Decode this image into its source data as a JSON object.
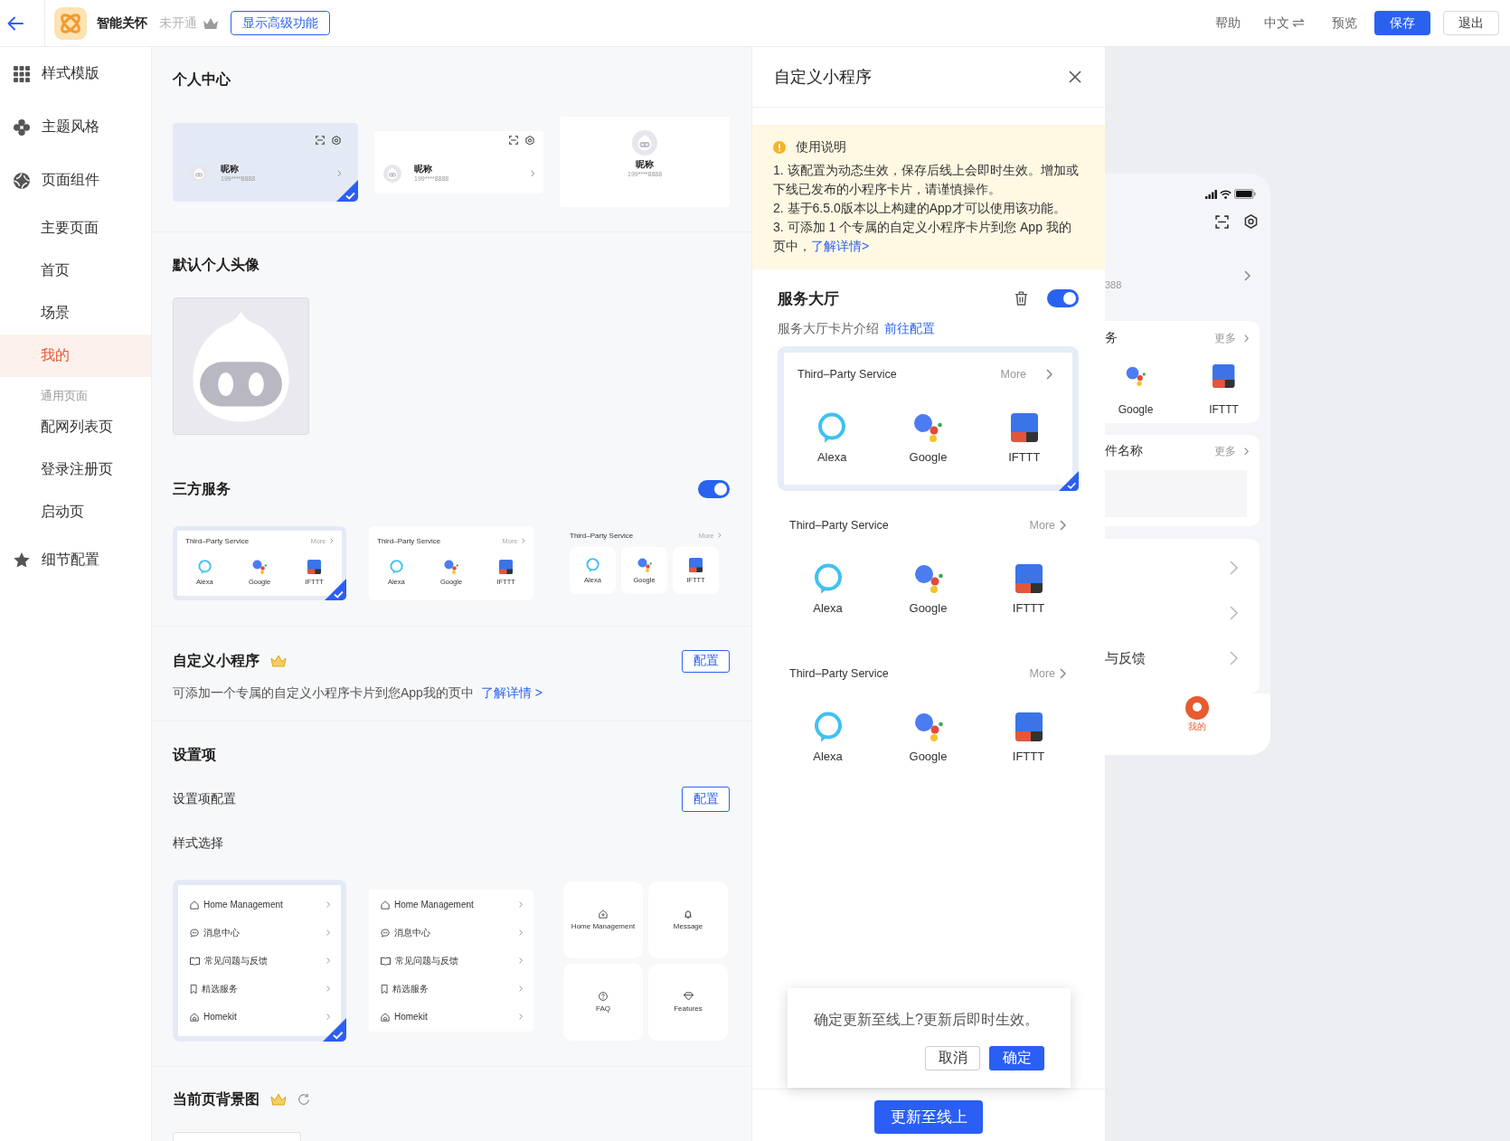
{
  "top_bar": {
    "app_name": "智能关怀",
    "plan_status": "未开通",
    "advanced_button": "显示高级功能",
    "actions": [
      {
        "kind": "help",
        "label": "帮助"
      },
      {
        "kind": "language",
        "label": "中文"
      },
      {
        "kind": "preview",
        "label": "预览"
      },
      {
        "kind": "save",
        "label": "保存"
      },
      {
        "kind": "exit",
        "label": "退出"
      }
    ]
  },
  "sidebar": {
    "items": [
      {
        "label": "样式模版"
      },
      {
        "label": "主题风格"
      },
      {
        "label": "页面组件",
        "children": [
          {
            "kind": "page",
            "label": "主要页面",
            "selected": false
          },
          {
            "kind": "page",
            "label": "首页",
            "selected": false
          },
          {
            "kind": "page",
            "label": "场景",
            "selected": false
          },
          {
            "kind": "page",
            "label": "我的",
            "selected": true
          },
          {
            "kind": "group",
            "label": "通用页面"
          },
          {
            "kind": "page",
            "label": "配网列表页",
            "selected": false
          },
          {
            "kind": "page",
            "label": "登录注册页",
            "selected": false
          },
          {
            "kind": "page",
            "label": "启动页",
            "selected": false
          }
        ]
      },
      {
        "label": "细节配置"
      }
    ]
  },
  "main": {
    "sections": [
      {
        "kind": "profile",
        "title": "个人中心",
        "options": [
          {
            "kind": "row",
            "selected": true,
            "nickname": "昵称",
            "phone": "199****8888"
          },
          {
            "kind": "row",
            "selected": false,
            "nickname": "昵称",
            "phone": "199****8888"
          },
          {
            "kind": "centered",
            "selected": false,
            "nickname": "昵称",
            "phone": "199****8888"
          }
        ]
      },
      {
        "kind": "avatar",
        "title": "默认个人头像"
      },
      {
        "kind": "third_party",
        "title": "三方服务",
        "enabled": true,
        "options": [
          {
            "kind": "card",
            "selected": true,
            "title": "Third–Party Service",
            "more": "More",
            "services": [
              {
                "kind": "ring",
                "label": "Alexa"
              },
              {
                "kind": "dots",
                "label": "Google"
              },
              {
                "kind": "blocks",
                "label": "IFTTT"
              }
            ]
          },
          {
            "kind": "card",
            "selected": false,
            "title": "Third–Party Service",
            "more": "More",
            "services": [
              {
                "kind": "ring",
                "label": "Alexa"
              },
              {
                "kind": "dots",
                "label": "Google"
              },
              {
                "kind": "blocks",
                "label": "IFTTT"
              }
            ]
          },
          {
            "kind": "tiles",
            "selected": false,
            "title": "Third–Party Service",
            "more": "More",
            "services": [
              {
                "kind": "ring",
                "label": "Alexa"
              },
              {
                "kind": "dots",
                "label": "Google"
              },
              {
                "kind": "blocks",
                "label": "IFTTT"
              }
            ]
          }
        ]
      },
      {
        "kind": "mini_program",
        "title": "自定义小程序",
        "premium": true,
        "button": "配置",
        "description": "可添加一个专属的自定义小程序卡片到您App我的页中",
        "link": "了解详情 >"
      },
      {
        "kind": "settings",
        "title": "设置项",
        "config_label": "设置项配置",
        "button": "配置",
        "style_label": "样式选择",
        "options": [
          {
            "kind": "list",
            "selected": true,
            "rows": [
              {
                "kind": "home",
                "label": "Home Management"
              },
              {
                "kind": "message",
                "label": "消息中心"
              },
              {
                "kind": "faq",
                "label": "常见问题与反馈"
              },
              {
                "kind": "featured",
                "label": "精选服务"
              },
              {
                "kind": "homekit",
                "label": "Homekit"
              }
            ]
          },
          {
            "kind": "list",
            "selected": false,
            "rows": [
              {
                "kind": "home",
                "label": "Home Management"
              },
              {
                "kind": "message",
                "label": "消息中心"
              },
              {
                "kind": "faq",
                "label": "常见问题与反馈"
              },
              {
                "kind": "featured",
                "label": "精选服务"
              },
              {
                "kind": "homekit",
                "label": "Homekit"
              }
            ]
          },
          {
            "kind": "grid",
            "selected": false,
            "tiles": [
              {
                "kind": "home",
                "label": "Home Management"
              },
              {
                "kind": "message",
                "label": "Message"
              },
              {
                "kind": "faq",
                "label": "FAQ"
              },
              {
                "kind": "featured",
                "label": "Features"
              }
            ]
          }
        ]
      },
      {
        "kind": "background",
        "title": "当前页背景图",
        "premium": true
      }
    ]
  },
  "drawer": {
    "title": "自定义小程序",
    "notice": {
      "title": "使用说明",
      "items": [
        {
          "text": "1. 该配置为动态生效，保存后线上会即时生效。增加或下线已发布的小程序卡片，请谨慎操作。"
        },
        {
          "text": "2. 基于6.5.0版本以上构建的App才可以使用该功能。"
        },
        {
          "text": "3. 可添加 1 个专属的自定义小程序卡片到您 App 我的页中，",
          "link": "了解详情>"
        }
      ]
    },
    "service_hall": {
      "title": "服务大厅",
      "enabled": true,
      "description": "服务大厅卡片介绍",
      "link": "前往配置",
      "cards": [
        {
          "selected": true,
          "title": "Third–Party Service",
          "more": "More",
          "services": [
            {
              "kind": "ring",
              "label": "Alexa"
            },
            {
              "kind": "dots",
              "label": "Google"
            },
            {
              "kind": "blocks",
              "label": "IFTTT"
            }
          ]
        },
        {
          "selected": false,
          "title": "Third–Party Service",
          "more": "More",
          "services": [
            {
              "kind": "ring",
              "label": "Alexa"
            },
            {
              "kind": "dots",
              "label": "Google"
            },
            {
              "kind": "blocks",
              "label": "IFTTT"
            }
          ]
        },
        {
          "selected": false,
          "title": "Third–Party Service",
          "more": "More",
          "services": [
            {
              "kind": "ring",
              "label": "Alexa"
            },
            {
              "kind": "dots",
              "label": "Google"
            },
            {
              "kind": "blocks",
              "label": "IFTTT"
            }
          ]
        }
      ]
    },
    "confirm": {
      "message": "确定更新至线上?更新后即时生效。",
      "buttons": [
        {
          "kind": "default",
          "label": "取消"
        },
        {
          "kind": "primary",
          "label": "确定"
        }
      ]
    },
    "publish_button": "更新至线上"
  },
  "preview": {
    "phone": "388",
    "cards": [
      {
        "kind": "services",
        "title": "务",
        "more": "更多",
        "services": [
          {
            "kind": "dots",
            "label": "Google"
          },
          {
            "kind": "blocks",
            "label": "IFTTT"
          }
        ]
      },
      {
        "kind": "placeholder",
        "title": "件名称",
        "more": "更多"
      }
    ],
    "menu": [
      {
        "kind": "blank"
      },
      {
        "kind": "blank"
      },
      {
        "kind": "labeled",
        "label": "与反馈"
      }
    ],
    "tab_bar": [
      {
        "label": "我的",
        "selected": true
      }
    ]
  }
}
